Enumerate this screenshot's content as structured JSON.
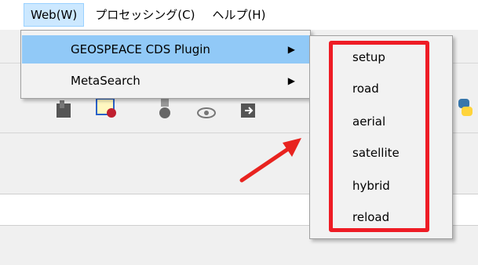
{
  "menubar": {
    "items": [
      {
        "label": "Web(W)"
      },
      {
        "label": "プロセッシング(C)"
      },
      {
        "label": "ヘルプ(H)"
      }
    ]
  },
  "web_menu": {
    "items": [
      {
        "label": "GEOSPEACE CDS Plugin",
        "arrow": "▶"
      },
      {
        "label": "MetaSearch",
        "arrow": "▶"
      }
    ]
  },
  "submenu": {
    "items": [
      {
        "label": "setup"
      },
      {
        "label": "road"
      },
      {
        "label": "aerial"
      },
      {
        "label": "satellite"
      },
      {
        "label": "hybrid"
      },
      {
        "label": "reload"
      }
    ]
  },
  "colors": {
    "highlight": "#91c9f7",
    "annotation": "#ee1c25"
  }
}
